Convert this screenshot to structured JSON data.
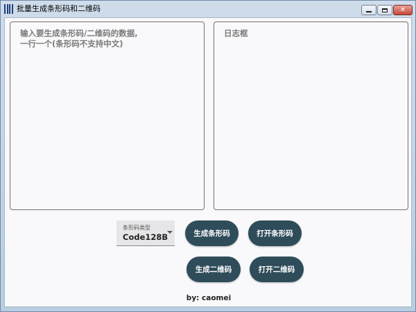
{
  "window": {
    "title": "批量生成条形码和二维码",
    "controls": {
      "minimize": "minimize-icon",
      "maximize": "maximize-icon",
      "close": "close-icon"
    }
  },
  "input_area": {
    "placeholder": "输入要生成条形码/二维码的数据,\n一行一个(条形码不支持中文)",
    "value": ""
  },
  "log_area": {
    "placeholder": "日志框",
    "value": ""
  },
  "barcode_type": {
    "label": "条形码类型",
    "selected": "Code128B"
  },
  "buttons": {
    "generate_barcode": "生成条形码",
    "open_barcode": "打开条形码",
    "generate_qrcode": "生成二维码",
    "open_qrcode": "打开二维码"
  },
  "footer": {
    "credit": "by: caomei"
  },
  "colors": {
    "button_bg": "#2f4c5a",
    "button_text": "#ffffff",
    "panel_bg": "#f9f9fb",
    "titlebar_bg": "#cfdcea"
  }
}
